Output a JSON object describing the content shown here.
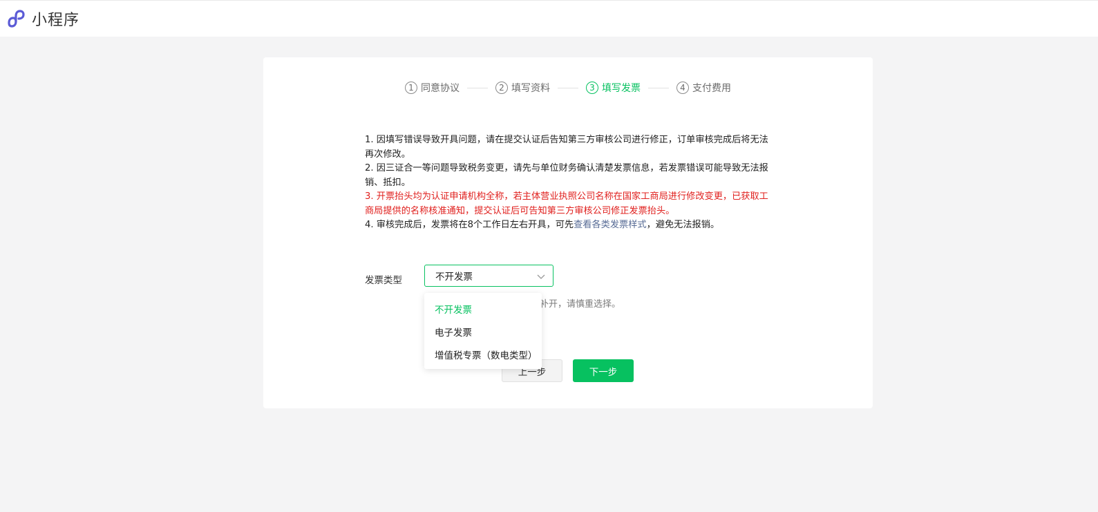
{
  "header": {
    "app_title": "小程序",
    "logo_icon": "mini-program-logo-icon",
    "logo_color": "#5b5bd6"
  },
  "steps": [
    {
      "num": "1",
      "label": "同意协议",
      "active": false
    },
    {
      "num": "2",
      "label": "填写资料",
      "active": false
    },
    {
      "num": "3",
      "label": "填写发票",
      "active": true
    },
    {
      "num": "4",
      "label": "支付费用",
      "active": false
    }
  ],
  "notes": {
    "line1": "1. 因填写错误导致开具问题，请在提交认证后告知第三方审核公司进行修正，订单审核完成后将无法再次修改。",
    "line2": "2. 因三证合一等问题导致税务变更，请先与单位财务确认清楚发票信息，若发票错误可能导致无法报销、抵扣。",
    "line3": "3. 开票抬头均为认证申请机构全称，若主体营业执照公司名称在国家工商局进行修改变更，已获取工商局提供的名称核准通知，提交认证后可告知第三方审核公司修正发票抬头。",
    "line4_prefix": "4. 审核完成后，发票将在8个工作日左右开具，可先",
    "line4_link": "查看各类发票样式",
    "line4_suffix": "，避免无法报销。"
  },
  "form": {
    "invoice_type_label": "发票类型",
    "invoice_type_value": "不开发票",
    "hint_visible": "补开，请慎重选择。"
  },
  "dropdown": {
    "options": [
      "不开发票",
      "电子发票",
      "增值税专票（数电类型）"
    ],
    "selected_index": 0
  },
  "buttons": {
    "prev_label": "上一步",
    "next_label": "下一步"
  },
  "colors": {
    "accent": "#07c160",
    "warning": "#e0201e",
    "link": "#576b95"
  }
}
